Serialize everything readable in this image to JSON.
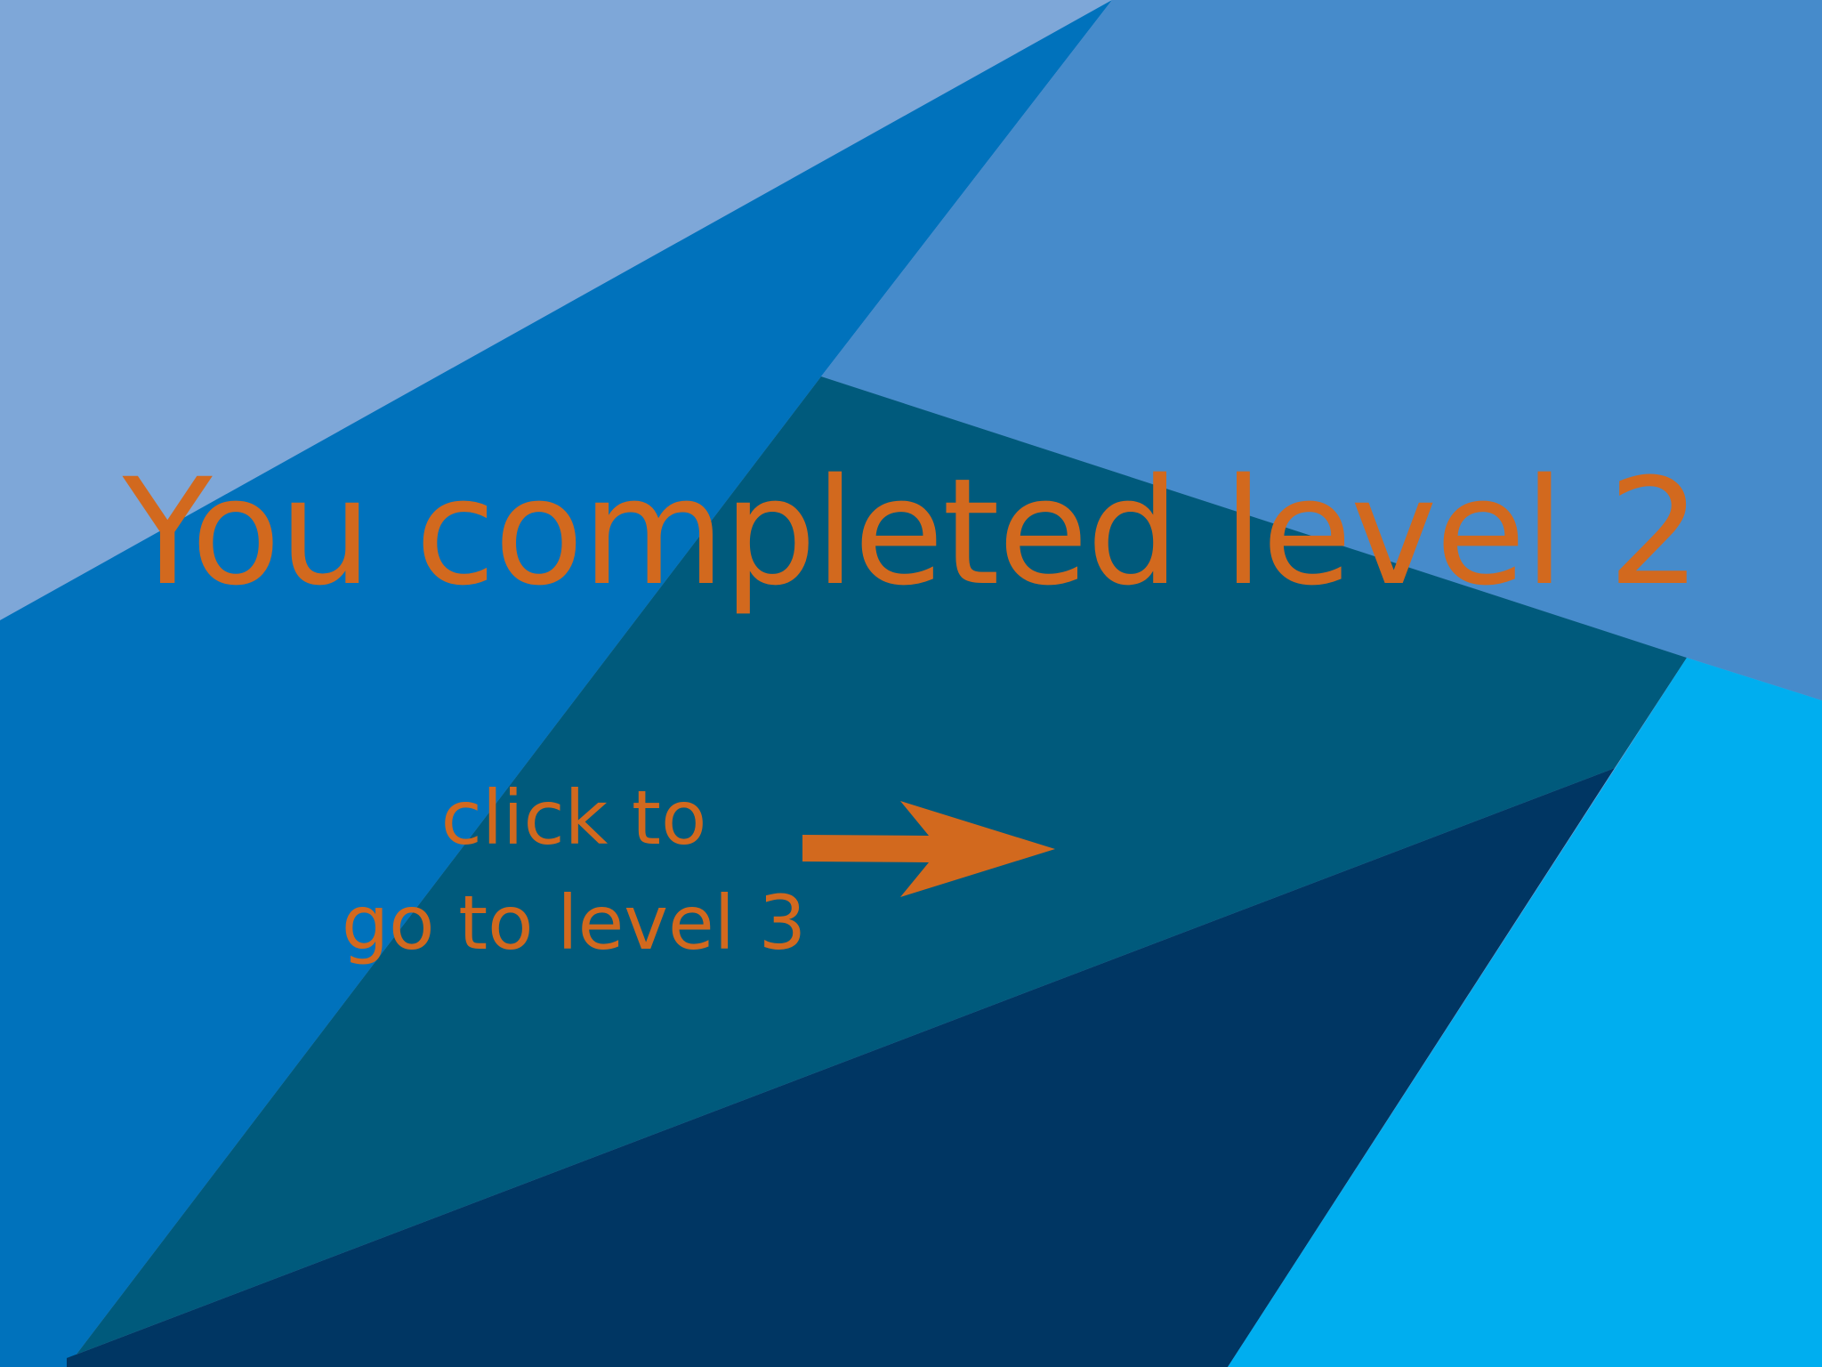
{
  "screen": {
    "title": "You completed level 2",
    "next": {
      "line1": "click to",
      "line2": "go to level 3",
      "icon": "right-arrow-icon"
    }
  },
  "colors": {
    "text": "#d2691e",
    "top_left": "#7ea7d8",
    "diagonal_band": "#0072bc",
    "top_right": "#468bcb",
    "center": "#005a7c",
    "bottom": "#003663",
    "right_cyan": "#00aeef"
  }
}
